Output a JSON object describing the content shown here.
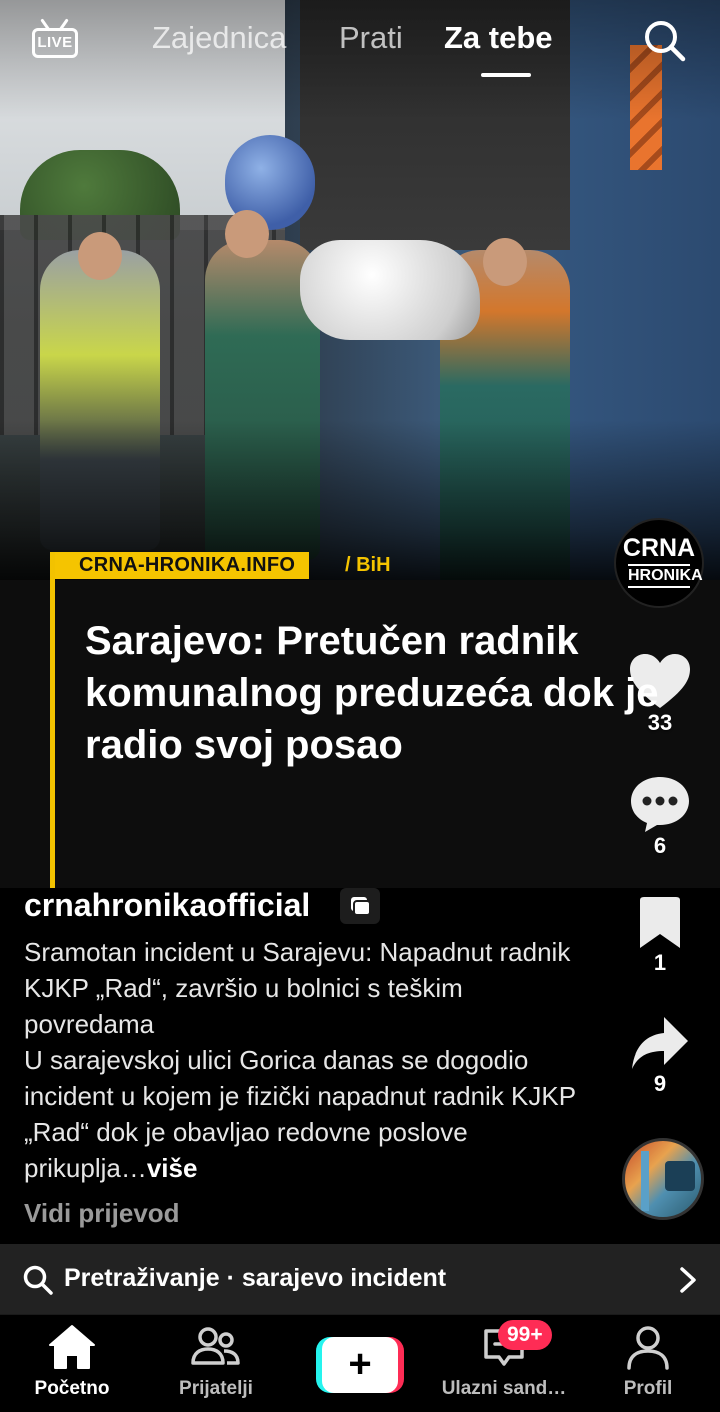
{
  "top_nav": {
    "live_label": "LIVE",
    "tabs": [
      {
        "label": "Zajednica",
        "active": false
      },
      {
        "label": "Prati",
        "active": false
      },
      {
        "label": "Za tebe",
        "active": true
      }
    ],
    "search_icon": "search-icon"
  },
  "news_card": {
    "source": "CRNA-HRONIKA.INFO",
    "region": "/ BiH",
    "headline": "Sarajevo: Pretučen radnik komunalnog preduzeća dok je radio svoj posao",
    "accent_color": "#f5c400"
  },
  "creator_avatar": {
    "line1": "CRNA",
    "line2": "HRONIKA"
  },
  "actions": {
    "likes": "33",
    "comments": "6",
    "saves": "1",
    "shares": "9"
  },
  "caption": {
    "username": "crnahronikaofficial",
    "description": "Sramotan incident u Sarajevu: Napadnut radnik KJKP „Rad“, završio u bolnici s teškim povredama\nU sarajevskoj ulici Gorica danas se dogodio incident u kojem je fizički napadnut radnik KJKP „Rad“ dok je obavljao redovne poslove prikuplja…",
    "more_label": "više",
    "translate_label": "Vidi prijevod"
  },
  "search_suggestion": {
    "text": "Pretraživanje · sarajevo incident"
  },
  "bottom_nav": {
    "home": "Početno",
    "friends": "Prijatelji",
    "create": "+",
    "inbox": "Ulazni sand…",
    "inbox_badge": "99+",
    "profile": "Profil",
    "badge_color": "#fe2c55"
  }
}
